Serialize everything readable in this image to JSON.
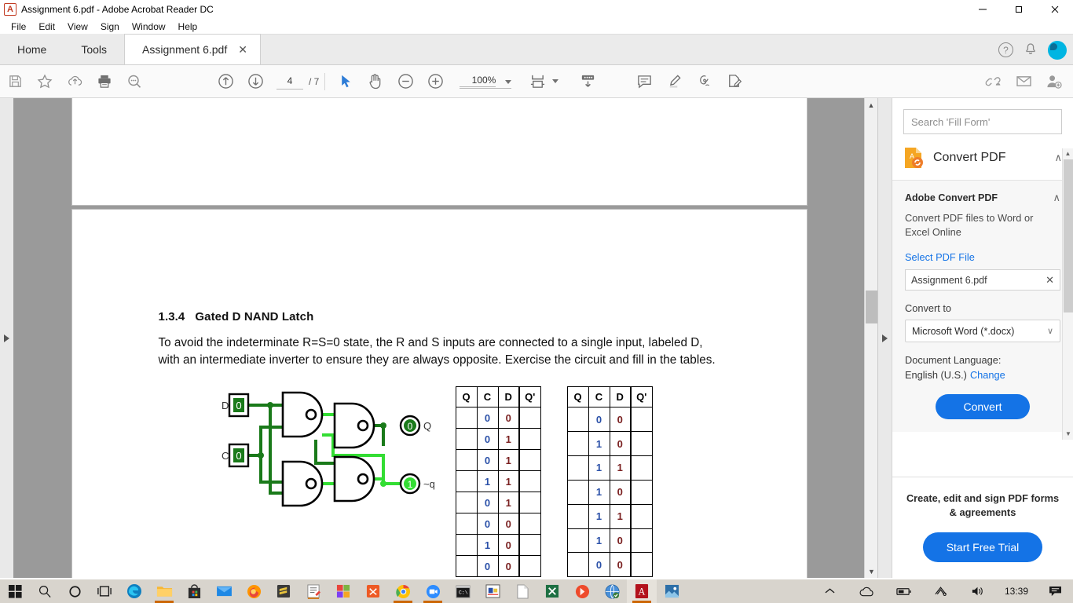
{
  "window": {
    "title": "Assignment 6.pdf - Adobe Acrobat Reader DC",
    "app_icon": "acrobat-icon",
    "minimize": "—",
    "maximize": "❐",
    "close": "✕"
  },
  "menubar": {
    "items": [
      "File",
      "Edit",
      "View",
      "Sign",
      "Window",
      "Help"
    ]
  },
  "tabbar": {
    "home": "Home",
    "tools": "Tools",
    "doc_tab": "Assignment 6.pdf",
    "close_glyph": "✕",
    "help_glyph": "?",
    "bell_glyph": "🔔"
  },
  "toolbar": {
    "save_label": "save-file",
    "page_current": "4",
    "page_total": "/ 7",
    "zoom_level": "100%",
    "caret_glyph": "▼"
  },
  "document": {
    "section_number": "1.3.4",
    "section_title": "Gated D NAND Latch",
    "paragraph": "To avoid the indeterminate R=S=0 state, the R and S inputs are connected to a single input, labeled D, with an intermediate inverter to ensure they are always opposite. Exercise the circuit and fill in the tables.",
    "circuit": {
      "input_d_label": "D",
      "input_d_value": "0",
      "input_c_label": "C",
      "input_c_value": "0",
      "output_q_label": "Q",
      "output_q_value": "0",
      "output_nq_label": "~q",
      "output_nq_value": "1",
      "wire_color_off": "#1a7a1a",
      "wire_color_on": "#33dd33"
    },
    "table1": {
      "headers": [
        "Q",
        "C",
        "D",
        "Q'"
      ],
      "rows": [
        [
          "",
          "0",
          "0",
          ""
        ],
        [
          "",
          "0",
          "1",
          ""
        ],
        [
          "",
          "0",
          "1",
          ""
        ],
        [
          "",
          "1",
          "1",
          ""
        ],
        [
          "",
          "0",
          "1",
          ""
        ],
        [
          "",
          "0",
          "0",
          ""
        ],
        [
          "",
          "1",
          "0",
          ""
        ],
        [
          "",
          "0",
          "0",
          ""
        ]
      ]
    },
    "table2": {
      "headers": [
        "Q",
        "C",
        "D",
        "Q'"
      ],
      "rows": [
        [
          "",
          "0",
          "0",
          ""
        ],
        [
          "",
          "1",
          "0",
          ""
        ],
        [
          "",
          "1",
          "1",
          ""
        ],
        [
          "",
          "1",
          "0",
          ""
        ],
        [
          "",
          "1",
          "1",
          ""
        ],
        [
          "",
          "1",
          "0",
          ""
        ],
        [
          "",
          "0",
          "0",
          ""
        ]
      ]
    },
    "colors": {
      "c_column": "#2a50a8",
      "d_column": "#7a2020"
    }
  },
  "sidebar": {
    "search_placeholder": "Search 'Fill Form'",
    "panel_title": "Convert PDF",
    "panel_chevron": "∧",
    "adobe_title": "Adobe Convert PDF",
    "adobe_chevron": "∧",
    "description": "Convert PDF files to Word or Excel Online",
    "select_file_label": "Select PDF File",
    "file_name": "Assignment 6.pdf",
    "file_clear": "✕",
    "convert_to_label": "Convert to",
    "convert_to_value": "Microsoft Word (*.docx)",
    "select_chevron": "∨",
    "doc_language_label": "Document Language:",
    "doc_language_value": "English (U.S.)",
    "change_link": "Change",
    "convert_button": "Convert",
    "promo_text": "Create, edit and sign PDF forms & agreements",
    "trial_button": "Start Free Trial",
    "accent_color": "#1473e6"
  },
  "taskbar": {
    "clock": "13:39",
    "items": [
      "start-button",
      "search-icon",
      "cortana-icon",
      "task-view-icon",
      "edge-icon",
      "file-explorer-icon",
      "microsoft-store-icon",
      "mail-icon",
      "firefox-icon",
      "sublime-text-icon",
      "notepad-icon",
      "office-icon",
      "xmind-icon",
      "chrome-icon",
      "zoom-icon",
      "command-prompt-icon",
      "logisim-icon",
      "blank-doc-icon",
      "excel-icon",
      "hotspot-icon",
      "browser-icon",
      "acrobat-icon",
      "photos-icon"
    ],
    "tray": [
      "show-hidden-icons",
      "onedrive-icon",
      "battery-icon",
      "wifi-icon",
      "volume-icon"
    ],
    "action_center": "notification-icon"
  }
}
